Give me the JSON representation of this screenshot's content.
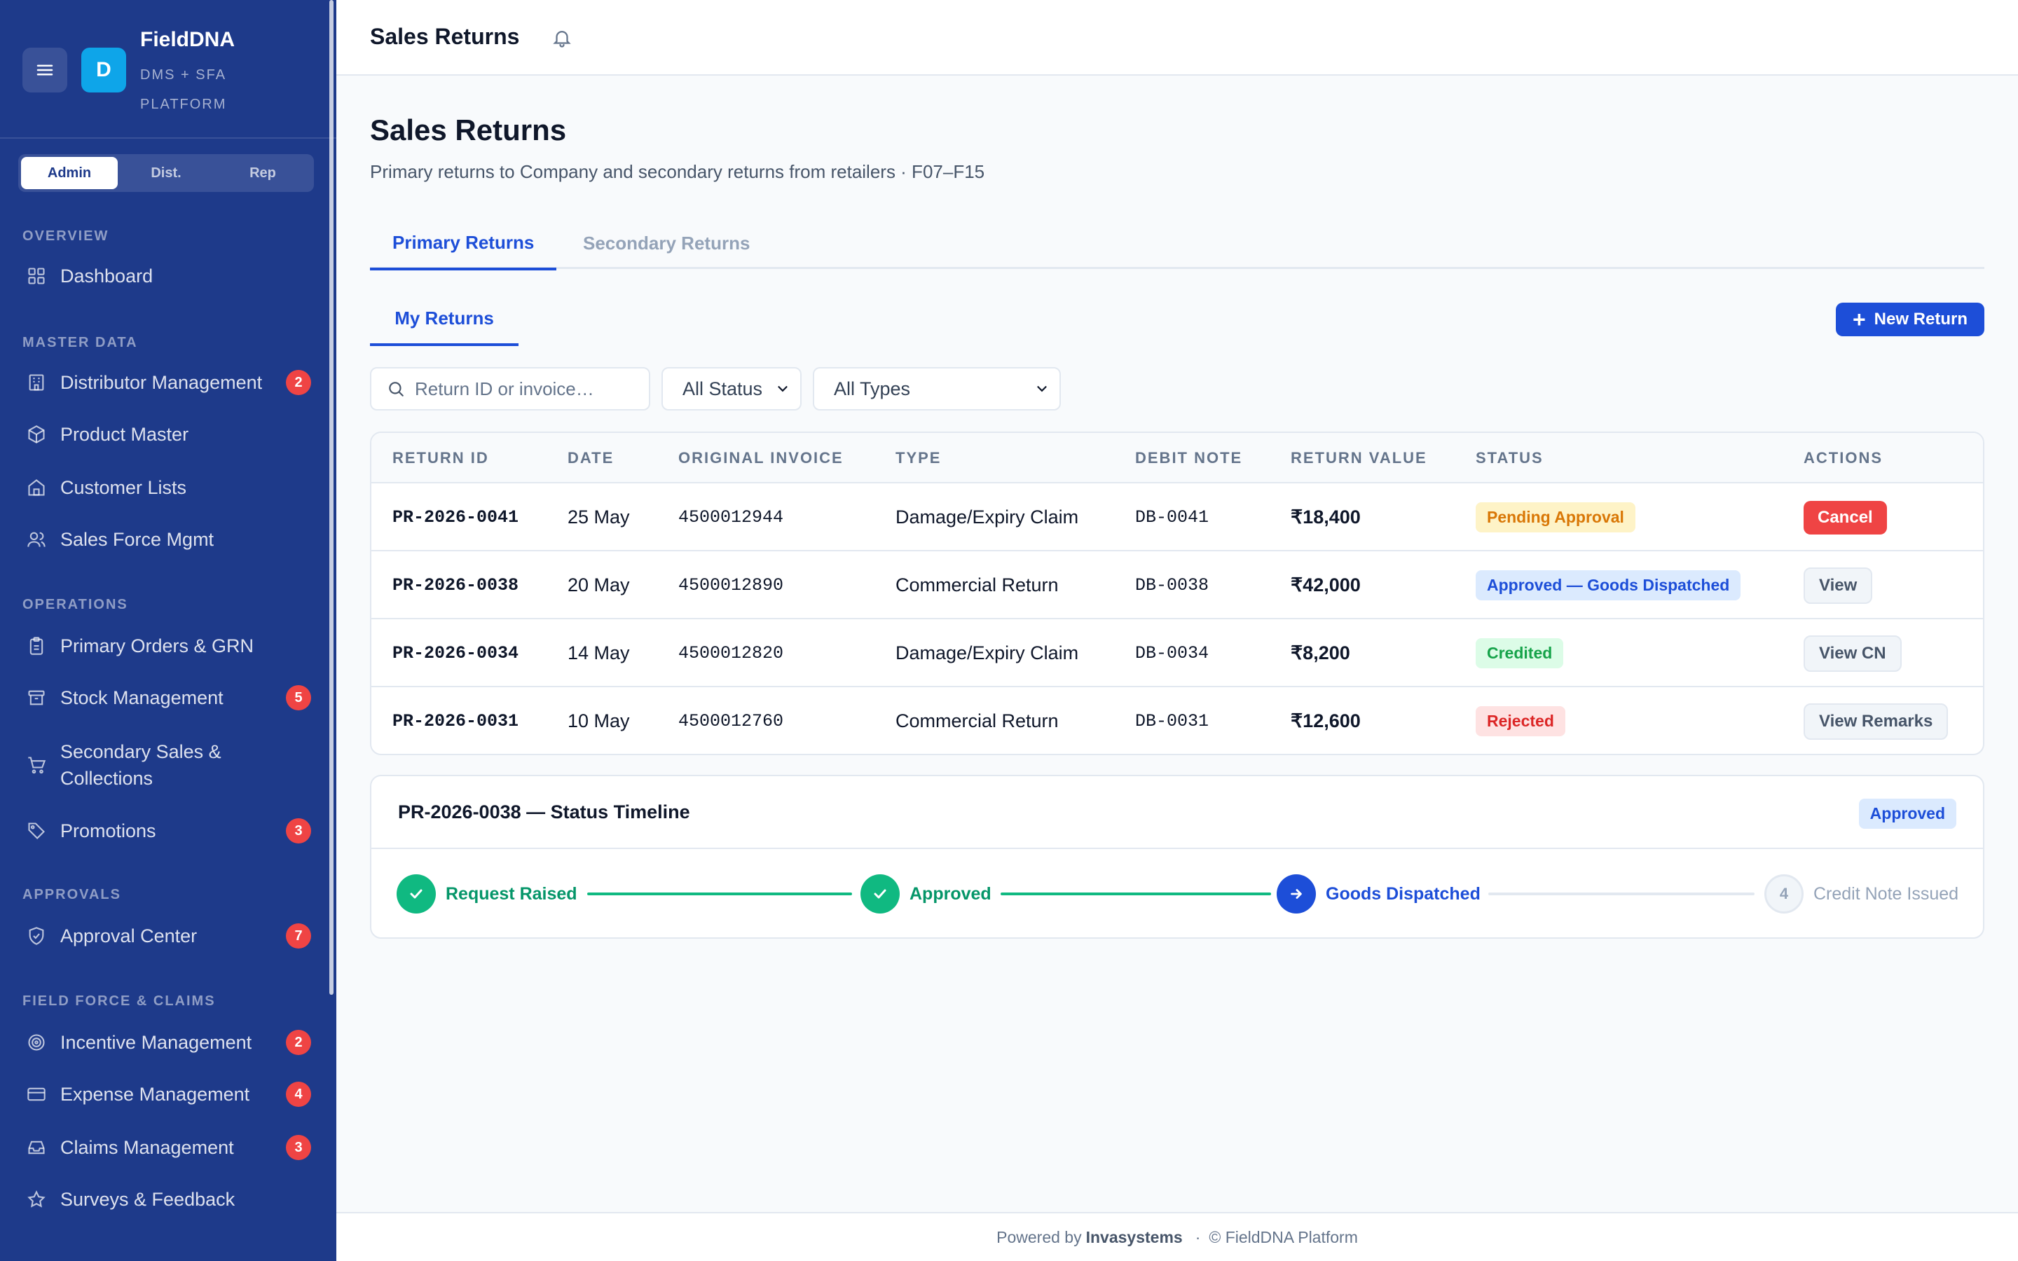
{
  "brand": {
    "name": "FieldDNA",
    "subtitle": "DMS + SFA PLATFORM",
    "logo_letter": "D",
    "logo_color": "#0ea5e9"
  },
  "roles": [
    "Admin",
    "Dist.",
    "Rep"
  ],
  "active_role": "Admin",
  "sidebar": {
    "sections": {
      "overview": "OVERVIEW",
      "master_data": "MASTER DATA",
      "operations": "OPERATIONS",
      "approvals": "APPROVALS",
      "field_force": "FIELD FORCE & CLAIMS"
    },
    "items": [
      {
        "label": "Dashboard",
        "icon": "grid-icon"
      },
      {
        "label": "Distributor Management",
        "icon": "building-icon",
        "badge": "2"
      },
      {
        "label": "Product Master",
        "icon": "box-icon"
      },
      {
        "label": "Customer Lists",
        "icon": "store-icon"
      },
      {
        "label": "Sales Force Mgmt",
        "icon": "users-icon"
      },
      {
        "label": "Primary Orders & GRN",
        "icon": "clipboard-icon"
      },
      {
        "label": "Stock Management",
        "icon": "archive-icon",
        "badge": "5"
      },
      {
        "label": "Secondary Sales & Collections",
        "icon": "cart-icon"
      },
      {
        "label": "Promotions",
        "icon": "tag-icon",
        "badge": "3"
      },
      {
        "label": "Approval Center",
        "icon": "shield-check-icon",
        "badge": "7"
      },
      {
        "label": "Incentive Management",
        "icon": "target-icon",
        "badge": "2"
      },
      {
        "label": "Expense Management",
        "icon": "credit-card-icon",
        "badge": "4"
      },
      {
        "label": "Claims Management",
        "icon": "inbox-icon",
        "badge": "3"
      },
      {
        "label": "Surveys & Feedback",
        "icon": "star-icon"
      }
    ]
  },
  "header": {
    "title": "Sales Returns",
    "bell_icon": "bell-icon"
  },
  "page": {
    "title": "Sales Returns",
    "subtitle": "Primary returns to Company and secondary returns from retailers · F07–F15",
    "tabs": [
      "Primary Returns",
      "Secondary Returns"
    ],
    "active_tab": "Primary Returns",
    "subtab": "My Returns",
    "new_button": "New Return",
    "accent": "#1d4ed8"
  },
  "filters": {
    "search_placeholder": "Return ID or invoice…",
    "status_value": "All Status",
    "type_value": "All Types"
  },
  "table": {
    "columns": [
      "RETURN ID",
      "DATE",
      "ORIGINAL INVOICE",
      "TYPE",
      "DEBIT NOTE",
      "RETURN VALUE",
      "STATUS",
      "ACTIONS"
    ],
    "rows": [
      {
        "id": "PR-2026-0041",
        "date": "25 May",
        "invoice": "4500012944",
        "type": "Damage/Expiry Claim",
        "debit_note": "DB-0041",
        "value": "₹18,400",
        "status": "Pending Approval",
        "status_kind": "pending",
        "action": "Cancel",
        "action_kind": "danger"
      },
      {
        "id": "PR-2026-0038",
        "date": "20 May",
        "invoice": "4500012890",
        "type": "Commercial Return",
        "debit_note": "DB-0038",
        "value": "₹42,000",
        "status": "Approved — Goods Dispatched",
        "status_kind": "approved",
        "action": "View",
        "action_kind": "ghost"
      },
      {
        "id": "PR-2026-0034",
        "date": "14 May",
        "invoice": "4500012820",
        "type": "Damage/Expiry Claim",
        "debit_note": "DB-0034",
        "value": "₹8,200",
        "status": "Credited",
        "status_kind": "credited",
        "action": "View CN",
        "action_kind": "ghost"
      },
      {
        "id": "PR-2026-0031",
        "date": "10 May",
        "invoice": "4500012760",
        "type": "Commercial Return",
        "debit_note": "DB-0031",
        "value": "₹12,600",
        "status": "Rejected",
        "status_kind": "rejected",
        "action": "View Remarks",
        "action_kind": "ghost"
      }
    ]
  },
  "timeline": {
    "title": "PR-2026-0038 — Status Timeline",
    "badge": "Approved",
    "steps": [
      {
        "label": "Request Raised",
        "state": "done",
        "mark": "✓"
      },
      {
        "label": "Approved",
        "state": "done",
        "mark": "✓"
      },
      {
        "label": "Goods Dispatched",
        "state": "current",
        "mark": "→"
      },
      {
        "label": "Credit Note Issued",
        "state": "todo",
        "mark": "4"
      }
    ]
  },
  "footer": {
    "prefix": "Powered by",
    "company": "Invasystems",
    "separator": "·",
    "suffix": "© FieldDNA Platform"
  }
}
